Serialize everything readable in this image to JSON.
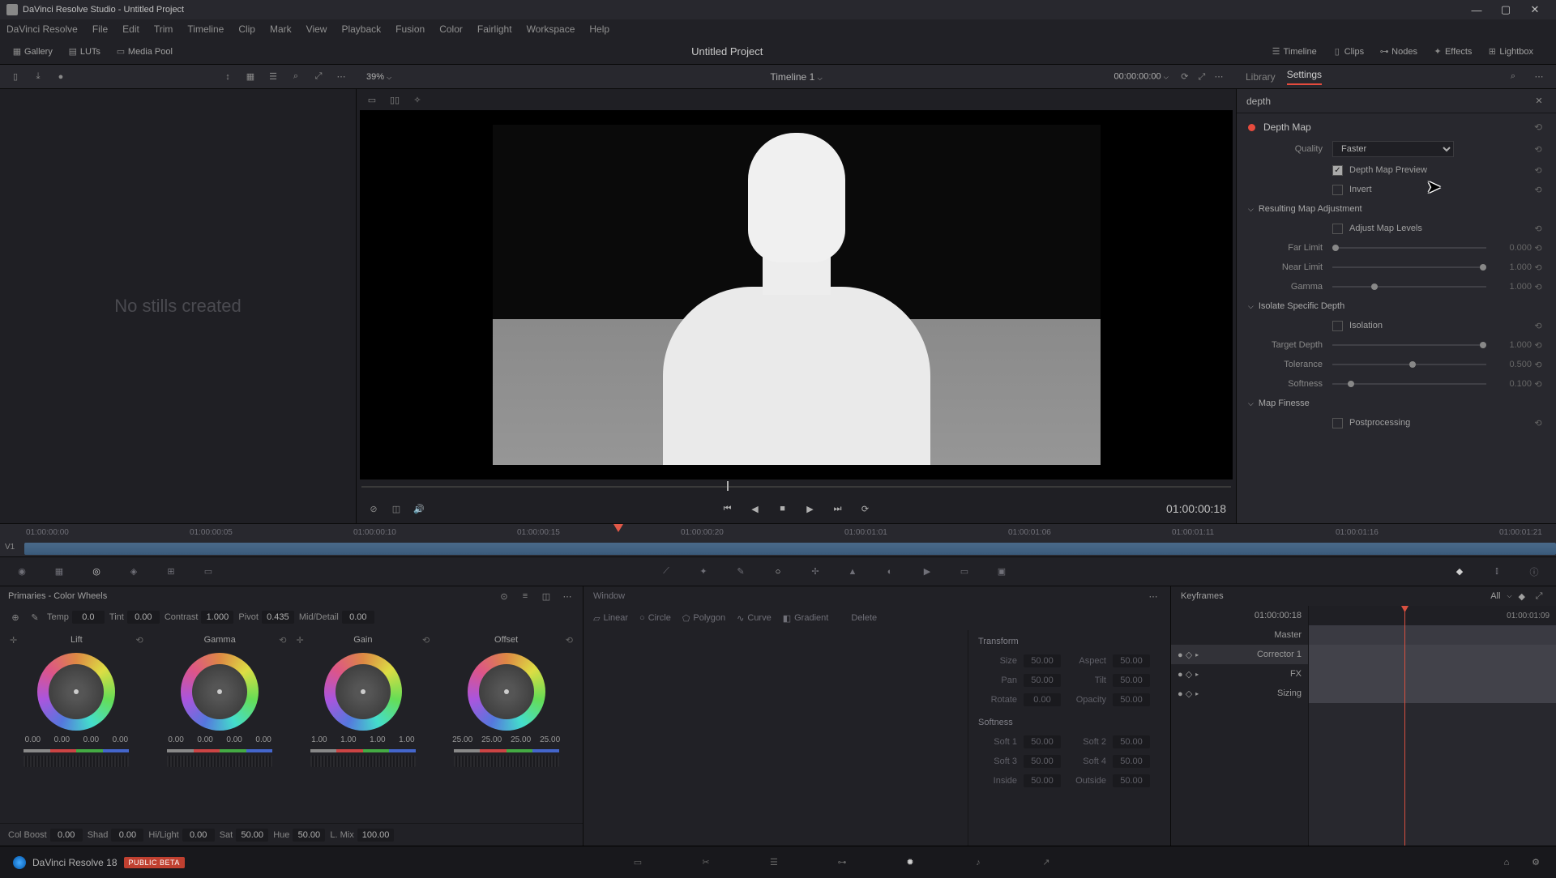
{
  "titlebar": {
    "text": "DaVinci Resolve Studio - Untitled Project"
  },
  "menu": [
    "DaVinci Resolve",
    "File",
    "Edit",
    "Trim",
    "Timeline",
    "Clip",
    "Mark",
    "View",
    "Playback",
    "Fusion",
    "Color",
    "Fairlight",
    "Workspace",
    "Help"
  ],
  "toolbar": {
    "gallery": "Gallery",
    "luts": "LUTs",
    "mediapool": "Media Pool",
    "project": "Untitled Project",
    "timeline": "Timeline",
    "clips": "Clips",
    "nodes": "Nodes",
    "effects": "Effects",
    "lightbox": "Lightbox"
  },
  "subbar": {
    "zoom": "39%",
    "timeline_name": "Timeline 1",
    "tc": "00:00:00:00",
    "library": "Library",
    "settings": "Settings"
  },
  "stills": {
    "empty": "No stills created"
  },
  "viewer": {
    "tc": "01:00:00:18"
  },
  "search": {
    "value": "depth"
  },
  "fx": {
    "title": "Depth Map",
    "quality_label": "Quality",
    "quality_value": "Faster",
    "preview_label": "Depth Map Preview",
    "invert_label": "Invert",
    "grp_map": "Resulting Map Adjustment",
    "adjust_levels": "Adjust Map Levels",
    "far_label": "Far Limit",
    "far_val": "0.000",
    "near_label": "Near Limit",
    "near_val": "1.000",
    "gamma_label": "Gamma",
    "gamma_val": "1.000",
    "grp_iso": "Isolate Specific Depth",
    "isolation": "Isolation",
    "target_label": "Target Depth",
    "target_val": "1.000",
    "tol_label": "Tolerance",
    "tol_val": "0.500",
    "soft_label": "Softness",
    "soft_val": "0.100",
    "grp_fin": "Map Finesse",
    "post": "Postprocessing"
  },
  "ruler": [
    "01:00:00:00",
    "01:00:00:05",
    "01:00:00:10",
    "01:00:00:15",
    "01:00:00:20",
    "01:00:01:01",
    "01:00:01:06",
    "01:00:01:11",
    "01:00:01:16",
    "01:00:01:21"
  ],
  "track": "V1",
  "wheels": {
    "title": "Primaries - Color Wheels",
    "adjust": {
      "temp_l": "Temp",
      "temp_v": "0.0",
      "tint_l": "Tint",
      "tint_v": "0.00",
      "contrast_l": "Contrast",
      "contrast_v": "1.000",
      "pivot_l": "Pivot",
      "pivot_v": "0.435",
      "md_l": "Mid/Detail",
      "md_v": "0.00"
    },
    "lift": "Lift",
    "gamma": "Gamma",
    "gain": "Gain",
    "offset": "Offset",
    "lift_v": [
      "0.00",
      "0.00",
      "0.00",
      "0.00"
    ],
    "gamma_v": [
      "0.00",
      "0.00",
      "0.00",
      "0.00"
    ],
    "gain_v": [
      "1.00",
      "1.00",
      "1.00",
      "1.00"
    ],
    "offset_v": [
      "25.00",
      "25.00",
      "25.00",
      "25.00"
    ],
    "bottom": {
      "colboost_l": "Col Boost",
      "colboost_v": "0.00",
      "shad_l": "Shad",
      "shad_v": "0.00",
      "hl_l": "Hi/Light",
      "hl_v": "0.00",
      "sat_l": "Sat",
      "sat_v": "50.00",
      "hue_l": "Hue",
      "hue_v": "50.00",
      "lmix_l": "L. Mix",
      "lmix_v": "100.00"
    }
  },
  "window": {
    "title": "Window",
    "linear": "Linear",
    "circle": "Circle",
    "polygon": "Polygon",
    "curve": "Curve",
    "gradient": "Gradient",
    "delete": "Delete",
    "transform": "Transform",
    "size_l": "Size",
    "size_v": "50.00",
    "aspect_l": "Aspect",
    "aspect_v": "50.00",
    "pan_l": "Pan",
    "pan_v": "50.00",
    "tilt_l": "Tilt",
    "tilt_v": "50.00",
    "rotate_l": "Rotate",
    "rotate_v": "0.00",
    "opacity_l": "Opacity",
    "opacity_v": "50.00",
    "softness": "Softness",
    "s1_l": "Soft 1",
    "s1_v": "50.00",
    "s2_l": "Soft 2",
    "s2_v": "50.00",
    "s3_l": "Soft 3",
    "s3_v": "50.00",
    "s4_l": "Soft 4",
    "s4_v": "50.00",
    "in_l": "Inside",
    "in_v": "50.00",
    "out_l": "Outside",
    "out_v": "50.00"
  },
  "kf": {
    "title": "Keyframes",
    "all": "All",
    "tc1": "01:00:00:18",
    "tc2": "01:00:01:09",
    "master": "Master",
    "c1": "Corrector 1",
    "fx": "FX",
    "sizing": "Sizing"
  },
  "pagebar": {
    "brand": "DaVinci Resolve 18",
    "badge": "PUBLIC BETA"
  }
}
